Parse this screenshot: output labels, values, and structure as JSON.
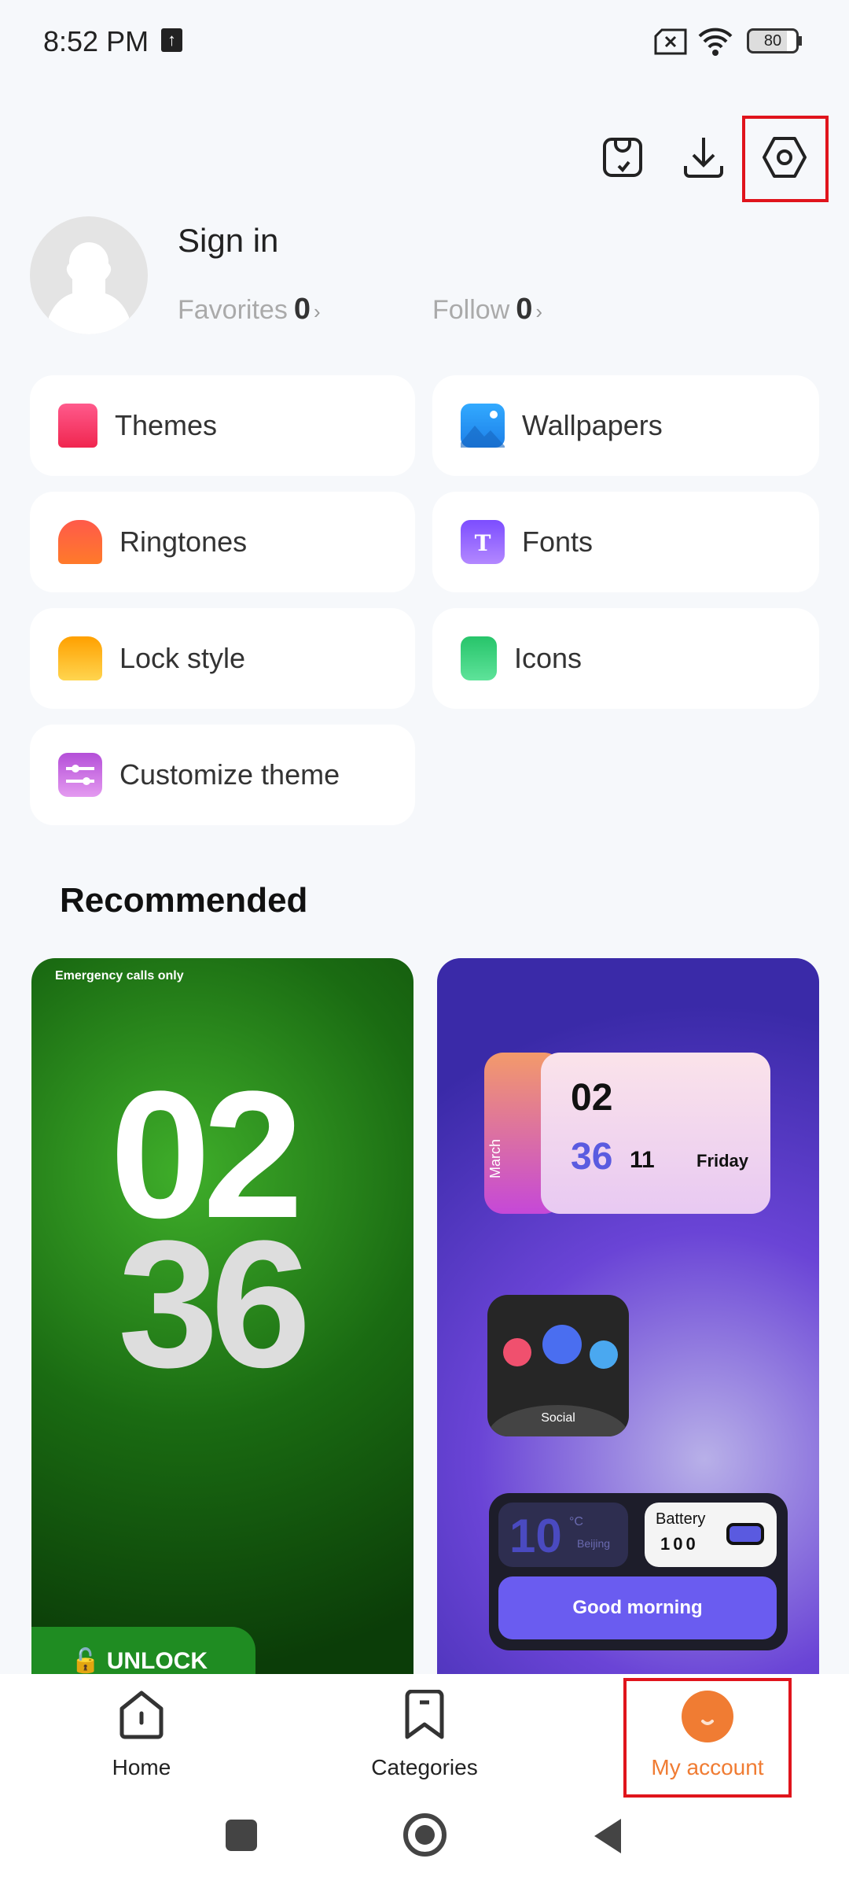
{
  "status_bar": {
    "time": "8:52 PM",
    "battery": "80"
  },
  "header": {
    "icons": [
      "wallet-check-icon",
      "download-icon",
      "settings-hexagon-icon"
    ]
  },
  "profile": {
    "sign_in": "Sign in",
    "favorites_label": "Favorites",
    "favorites_count": "0",
    "follow_label": "Follow",
    "follow_count": "0",
    "chevron": "›"
  },
  "menu": [
    {
      "label": "Themes",
      "icon": "themes-icon",
      "color": "#f43f6f"
    },
    {
      "label": "Wallpapers",
      "icon": "wallpapers-icon",
      "color": "#2196f3"
    },
    {
      "label": "Ringtones",
      "icon": "ringtones-icon",
      "color": "#ff6a3d"
    },
    {
      "label": "Fonts",
      "icon": "fonts-icon",
      "color": "#8a5cf6"
    },
    {
      "label": "Lock style",
      "icon": "lock-style-icon",
      "color": "#ffb300"
    },
    {
      "label": "Icons",
      "icon": "icons-icon",
      "color": "#2ecc71"
    },
    {
      "label": "Customize theme",
      "icon": "customize-theme-icon",
      "color": "#c163e0"
    }
  ],
  "recommended": {
    "title": "Recommended",
    "left": {
      "status": "Emergency calls only",
      "hour": "02",
      "minute": "36",
      "unlock": "🔓 UNLOCK"
    },
    "right": {
      "month": "March",
      "hour": "02",
      "minute": "36",
      "day": "11",
      "weekday": "Friday",
      "social": "Social",
      "temp": "10",
      "temp_unit": "°C",
      "city": "Beijing",
      "battery_label": "Battery",
      "battery_value": "100",
      "greeting": "Good morning"
    }
  },
  "bottom_nav": [
    {
      "label": "Home",
      "icon": "home-icon",
      "active": false
    },
    {
      "label": "Categories",
      "icon": "categories-icon",
      "active": false
    },
    {
      "label": "My account",
      "icon": "my-account-icon",
      "active": true
    }
  ],
  "accent": "#f07c33"
}
